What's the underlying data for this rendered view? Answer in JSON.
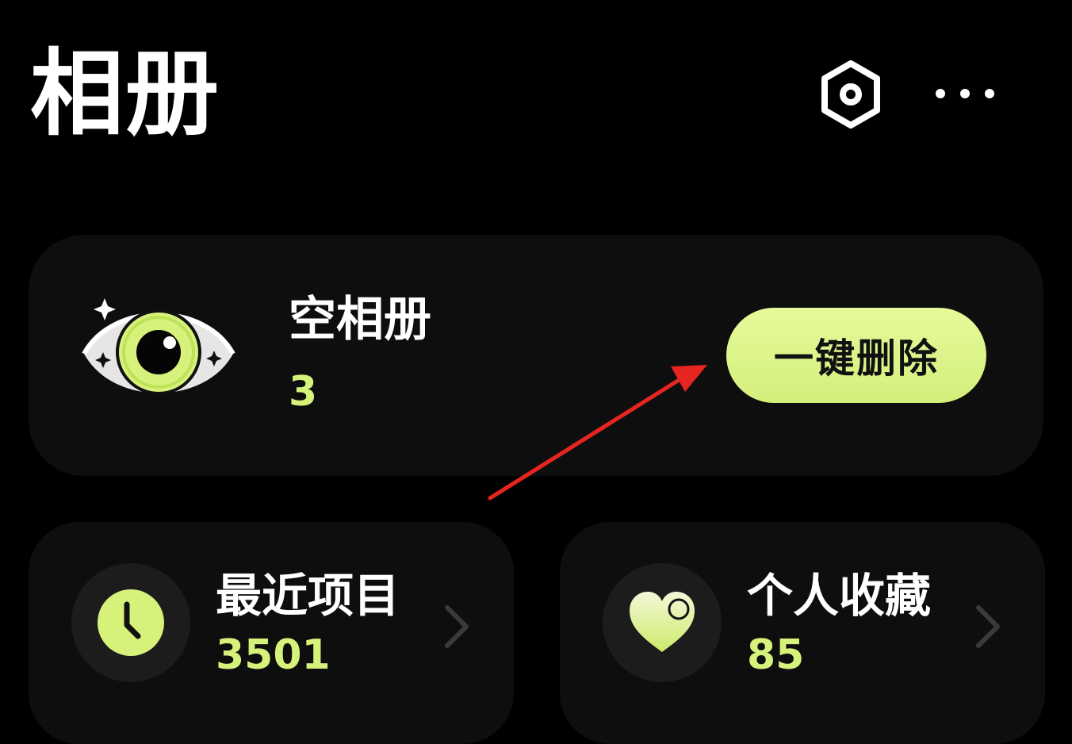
{
  "header": {
    "title": "相册",
    "settings_icon": "settings-icon",
    "more_icon": "more-horizontal-icon"
  },
  "empty_albums": {
    "title": "空相册",
    "count": "3",
    "action_label": "一键删除",
    "icon": "eye-icon"
  },
  "recent": {
    "title": "最近项目",
    "count": "3501",
    "icon": "clock-icon"
  },
  "favorites": {
    "title": "个人收藏",
    "count": "85",
    "icon": "heart-icon"
  },
  "colors": {
    "accent": "#d6f27a",
    "background": "#000000",
    "card": "#0e0e0e",
    "annotation": "#e62420"
  }
}
